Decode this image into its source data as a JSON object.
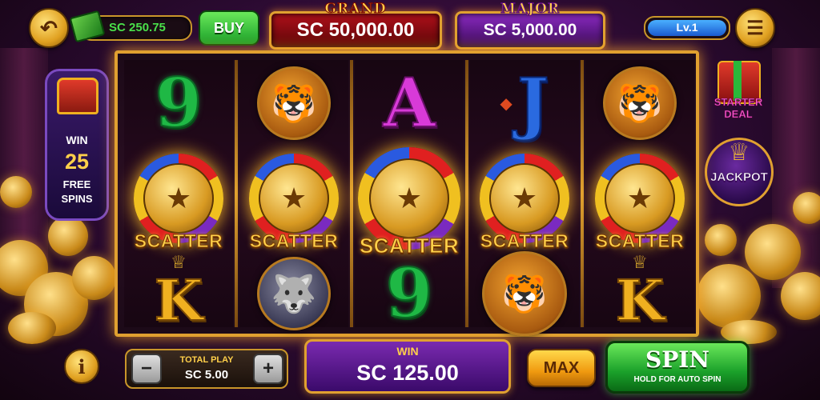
{
  "header": {
    "balance": "SC 250.75",
    "buy_label": "BUY",
    "grand_title": "GRAND",
    "grand_value": "SC 50,000.00",
    "major_title": "MAJOR",
    "major_value": "SC 5,000.00",
    "level": "Lv.1",
    "icons": {
      "back": "back-arrow-icon",
      "cash": "cash-stack-icon",
      "menu": "menu-icon"
    }
  },
  "left_panel": {
    "win_label": "WIN",
    "free_spins_count": "25",
    "free_spins_label_1": "FREE",
    "free_spins_label_2": "SPINS",
    "icon": "treasure-chest-icon"
  },
  "right_panel": {
    "starter_deal": "STARTER DEAL",
    "jackpot": "JACKPOT"
  },
  "reels": [
    {
      "top": "9",
      "middle": "SCATTER",
      "bottom": "K"
    },
    {
      "top": "tiger",
      "middle": "SCATTER",
      "bottom": "wolf"
    },
    {
      "top": "A",
      "middle": "SCATTER",
      "bottom": "9"
    },
    {
      "top": "J",
      "middle": "SCATTER",
      "bottom": "tiger"
    },
    {
      "top": "tiger",
      "middle": "SCATTER",
      "bottom": "K"
    }
  ],
  "bottom": {
    "total_play_label": "TOTAL PLAY",
    "total_play_value": "SC 5.00",
    "minus": "−",
    "plus": "+",
    "win_label": "WIN",
    "win_value": "SC 125.00",
    "max_label": "MAX",
    "spin_label": "SPIN",
    "spin_sub": "HOLD FOR AUTO SPIN",
    "info": "i"
  },
  "colors": {
    "gold": "#e0a030",
    "purple": "#5a1a7a",
    "green": "#2ab83a"
  }
}
